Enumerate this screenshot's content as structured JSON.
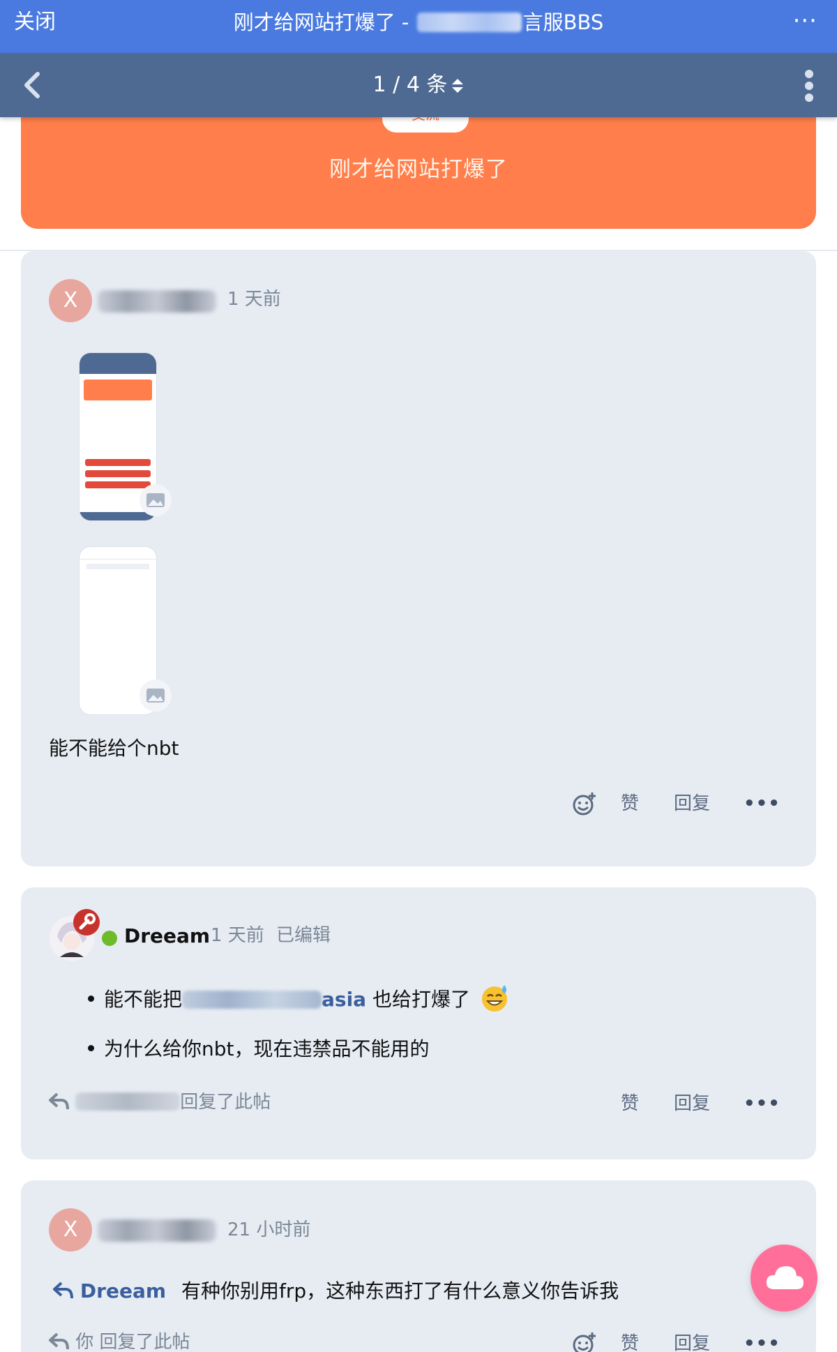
{
  "topbar": {
    "close_label": "关闭",
    "title_prefix": "刚才给网站打爆了 - ",
    "title_suffix": "言服BBS",
    "more_label": "···"
  },
  "navbar": {
    "pager_label": "1 / 4 条"
  },
  "hero": {
    "tag_label": "交流",
    "title": "刚才给网站打爆了"
  },
  "posts": [
    {
      "avatar_letter": "X",
      "time": "1 天前",
      "text": "能不能给个nbt",
      "actions": {
        "like": "赞",
        "reply": "回复",
        "more": "•••"
      }
    },
    {
      "author": "Dreeam",
      "time": "1 天前",
      "edited": "已编辑",
      "bullets": [
        {
          "prefix": "能不能把",
          "link_suffix": "asia",
          "suffix": " 也给打爆了"
        },
        {
          "text": "为什么给你nbt，现在违禁品不能用的"
        }
      ],
      "reply_note": "回复了此帖",
      "actions": {
        "like": "赞",
        "reply": "回复",
        "more": "•••"
      }
    },
    {
      "avatar_letter": "X",
      "time": "21 小时前",
      "reply_to": "Dreeam",
      "text": "有种你别用frp，这种东西打了有什么意义你告诉我",
      "reply_note": "你 回复了此帖",
      "actions": {
        "like": "赞",
        "reply": "回复",
        "more": "•••"
      }
    }
  ],
  "colors": {
    "topbar": "#4a7ae0",
    "navbar": "#4e6a93",
    "hero": "#ff7e4b",
    "card": "#e7ecf3",
    "fab": "#ff6f9a"
  }
}
